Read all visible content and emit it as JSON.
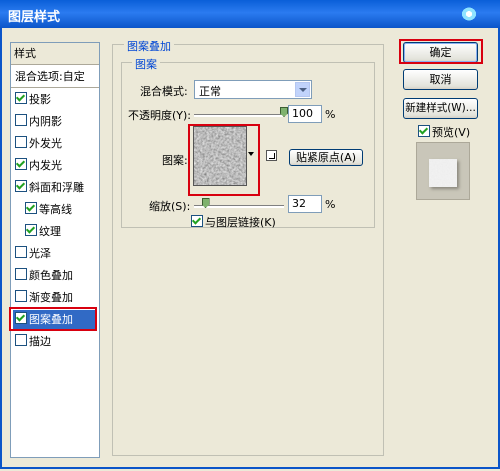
{
  "window": {
    "title": "图层样式"
  },
  "styles_list": {
    "header": "样式",
    "blend_options": "混合选项:自定",
    "items": [
      {
        "label": "投影",
        "checked": true
      },
      {
        "label": "内阴影",
        "checked": false
      },
      {
        "label": "外发光",
        "checked": false
      },
      {
        "label": "内发光",
        "checked": true
      },
      {
        "label": "斜面和浮雕",
        "checked": true
      },
      {
        "label": "等高线",
        "checked": true
      },
      {
        "label": "纹理",
        "checked": true
      },
      {
        "label": "光泽",
        "checked": false
      },
      {
        "label": "颜色叠加",
        "checked": false
      },
      {
        "label": "渐变叠加",
        "checked": false
      },
      {
        "label": "图案叠加",
        "checked": true,
        "selected": true
      },
      {
        "label": "描边",
        "checked": false
      }
    ]
  },
  "panel": {
    "group_title": "图案叠加",
    "subgroup_title": "图案",
    "blend_mode_label": "混合模式:",
    "blend_mode_value": "正常",
    "opacity_label": "不透明度(Y):",
    "opacity_value": "100",
    "opacity_fraction": 1.0,
    "percent": "%",
    "pattern_label": "图案:",
    "snap_origin_button": "贴紧原点(A)",
    "scale_label": "缩放(S):",
    "scale_value": "32",
    "scale_fraction": 0.32,
    "link_layer_label": "与图层链接(K)",
    "link_layer_checked": true
  },
  "buttons": {
    "ok": "确定",
    "cancel": "取消",
    "new_style": "新建样式(W)...",
    "preview_label": "预览(V)",
    "preview_checked": true
  },
  "colors": {
    "titlebar": "#0a5fd8",
    "selection": "#316ac5",
    "highlight_box": "#d8000f"
  }
}
